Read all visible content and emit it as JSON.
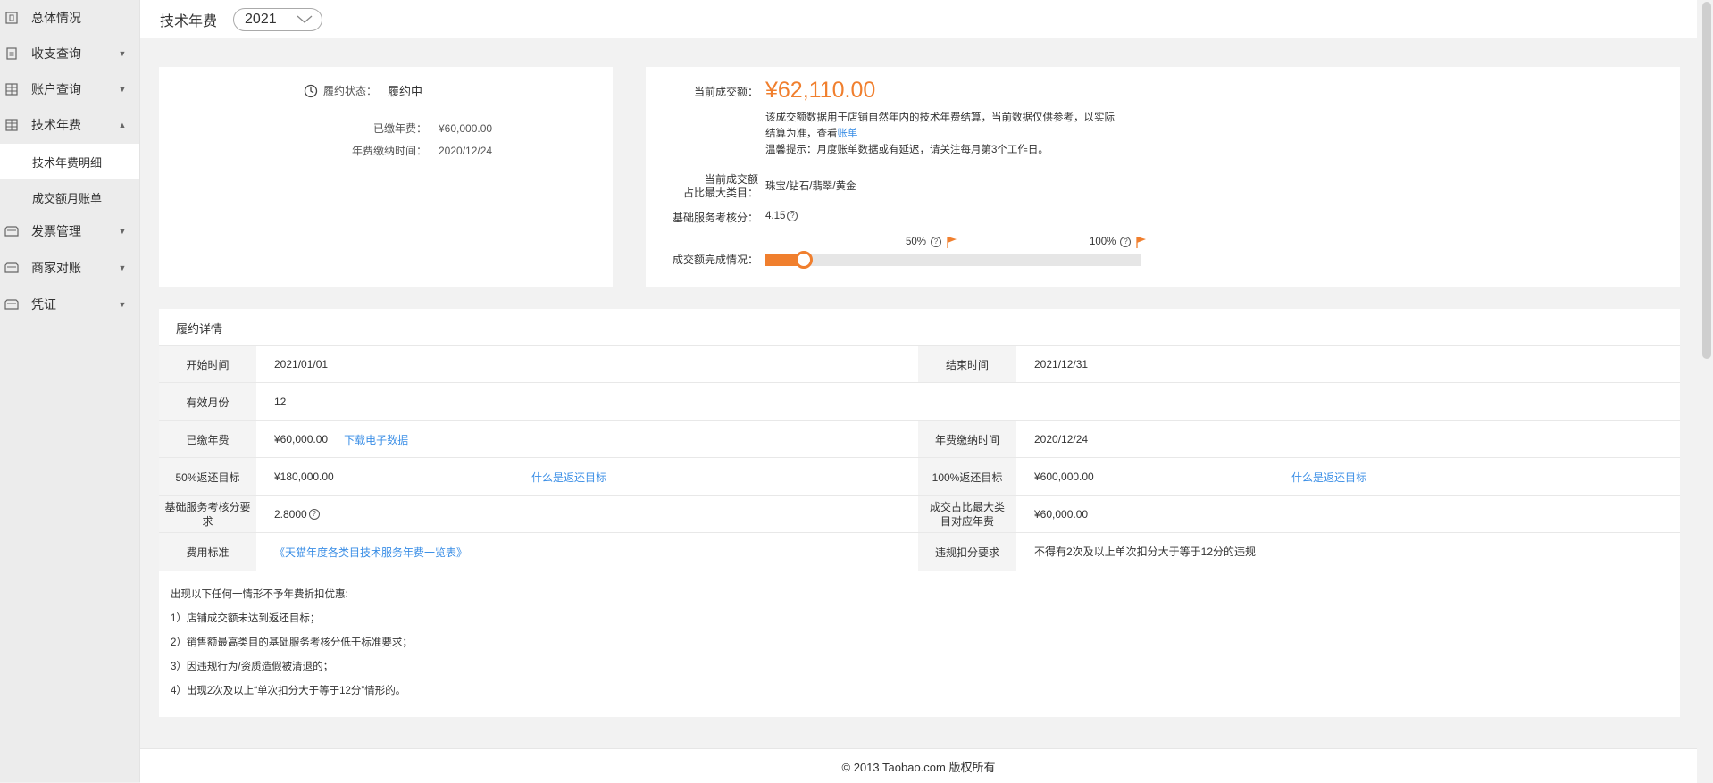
{
  "sidebar": {
    "items": [
      {
        "label": "总体情况",
        "icon": "overview-icon"
      },
      {
        "label": "收支查询",
        "icon": "document-icon"
      },
      {
        "label": "账户查询",
        "icon": "grid-icon"
      },
      {
        "label": "技术年费",
        "icon": "grid-icon"
      },
      {
        "label": "发票管理",
        "icon": "folder-icon"
      },
      {
        "label": "商家对账",
        "icon": "folder-icon"
      },
      {
        "label": "凭证",
        "icon": "folder-icon"
      }
    ],
    "sub_items": [
      {
        "label": "技术年费明细",
        "active": true
      },
      {
        "label": "成交额月账单",
        "active": false
      }
    ]
  },
  "header": {
    "title": "技术年费",
    "year": "2021"
  },
  "status_card": {
    "status_label": "履约状态：",
    "status_value": "履约中",
    "paid_label": "已缴年费：",
    "paid_value": "¥60,000.00",
    "paid_time_label": "年费缴纳时间：",
    "paid_time_value": "2020/12/24"
  },
  "summary_card": {
    "current_label": "当前成交额：",
    "current_amount": "¥62,110.00",
    "desc_line1": "该成交额数据用于店铺自然年内的技术年费结算，当前数据仅供参考，以实际",
    "desc_line2_prefix": "结算为准，查看",
    "desc_line2_link": "账单",
    "tip": "温馨提示：月度账单数据或有延迟，请关注每月第3个工作日。",
    "category_label_1": "当前成交额",
    "category_label_2": "占比最大类目：",
    "category_value": "珠宝/钻石/翡翠/黄金",
    "score_label": "基础服务考核分：",
    "score_value": "4.15",
    "progress_label": "成交额完成情况：",
    "progress_fraction": 0.1035,
    "mark_50": "50%",
    "mark_100": "100%",
    "accent_color": "#f07f2e"
  },
  "detail": {
    "title": "履约详情",
    "rows": [
      {
        "h1": "开始时间",
        "v1": "2021/01/01",
        "h2": "结束时间",
        "v2": "2021/12/31"
      },
      {
        "h1": "有效月份",
        "v1": "12"
      },
      {
        "h1": "已缴年费",
        "v1": "¥60,000.00",
        "v1_link": "下载电子数据",
        "h2": "年费缴纳时间",
        "v2": "2020/12/24"
      },
      {
        "h1": "50%返还目标",
        "v1": "¥180,000.00",
        "v1_link": "什么是返还目标",
        "h2": "100%返还目标",
        "v2": "¥600,000.00",
        "v2_link": "什么是返还目标"
      },
      {
        "h1": "基础服务考核分要求",
        "v1": "2.8000",
        "h2": "成交占比最大类目对应年费",
        "v2": "¥60,000.00"
      },
      {
        "h1": "费用标准",
        "v1_link": "《天猫年度各类目技术服务年费一览表》",
        "h2": "违规扣分要求",
        "v2": "不得有2次及以上单次扣分大于等于12分的违规"
      }
    ],
    "notes": [
      "出现以下任何一情形不予年费折扣优惠:",
      "1）店铺成交额未达到返还目标；",
      "2）销售额最高类目的基础服务考核分低于标准要求；",
      "3）因违规行为/资质造假被清退的；",
      "4）出现2次及以上“单次扣分大于等于12分”情形的。"
    ]
  },
  "footer": {
    "text": "© 2013 Taobao.com 版权所有"
  }
}
